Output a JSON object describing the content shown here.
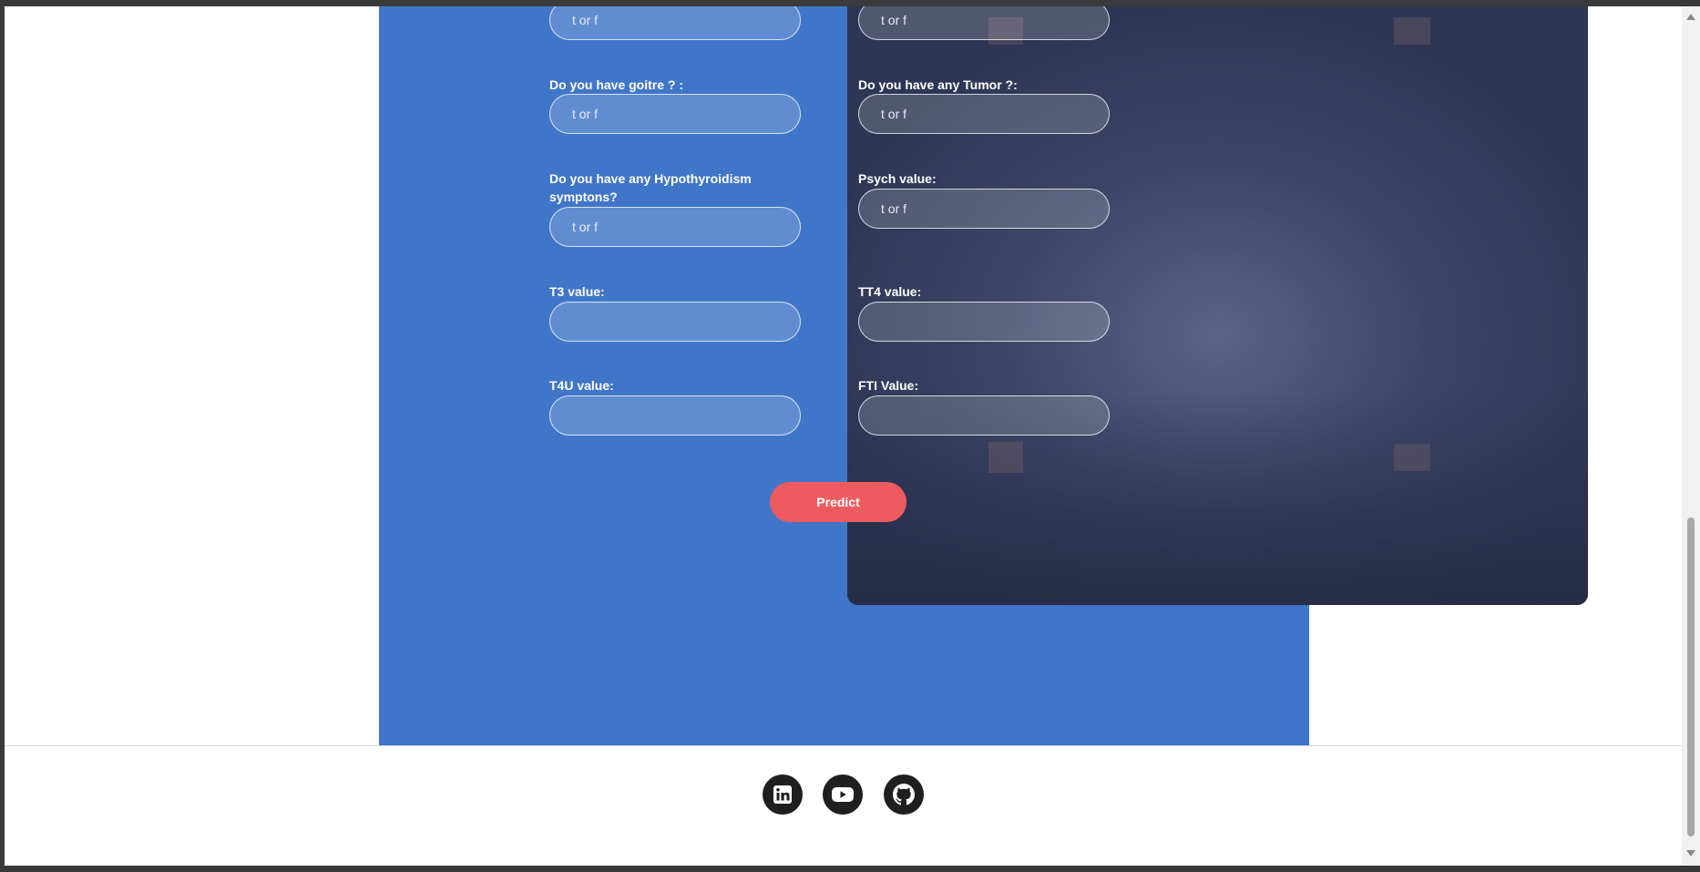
{
  "form": {
    "fields": [
      {
        "label": "",
        "placeholder": "t or f"
      },
      {
        "label": "",
        "placeholder": "t or f"
      },
      {
        "label": "Do you have goitre ? :",
        "placeholder": "t or f"
      },
      {
        "label": "Do you have any Tumor ?:",
        "placeholder": "t or f"
      },
      {
        "label": "Do you have any Hypothyroidism symptons?",
        "placeholder": "t or f"
      },
      {
        "label": "Psych value:",
        "placeholder": "t or f"
      },
      {
        "label": "T3 value:",
        "placeholder": ""
      },
      {
        "label": "TT4 value:",
        "placeholder": ""
      },
      {
        "label": "T4U value:",
        "placeholder": ""
      },
      {
        "label": "FTI Value:",
        "placeholder": ""
      }
    ],
    "submit_label": "Predict"
  },
  "footer": {
    "social": [
      {
        "name": "linkedin-icon"
      },
      {
        "name": "youtube-icon"
      },
      {
        "name": "github-icon"
      }
    ]
  },
  "colors": {
    "panel_blue": "#4076c8",
    "card_bg": "#333b5c",
    "predict_button": "#ee5b5f",
    "social_icon_bg": "#1f1f1f"
  }
}
